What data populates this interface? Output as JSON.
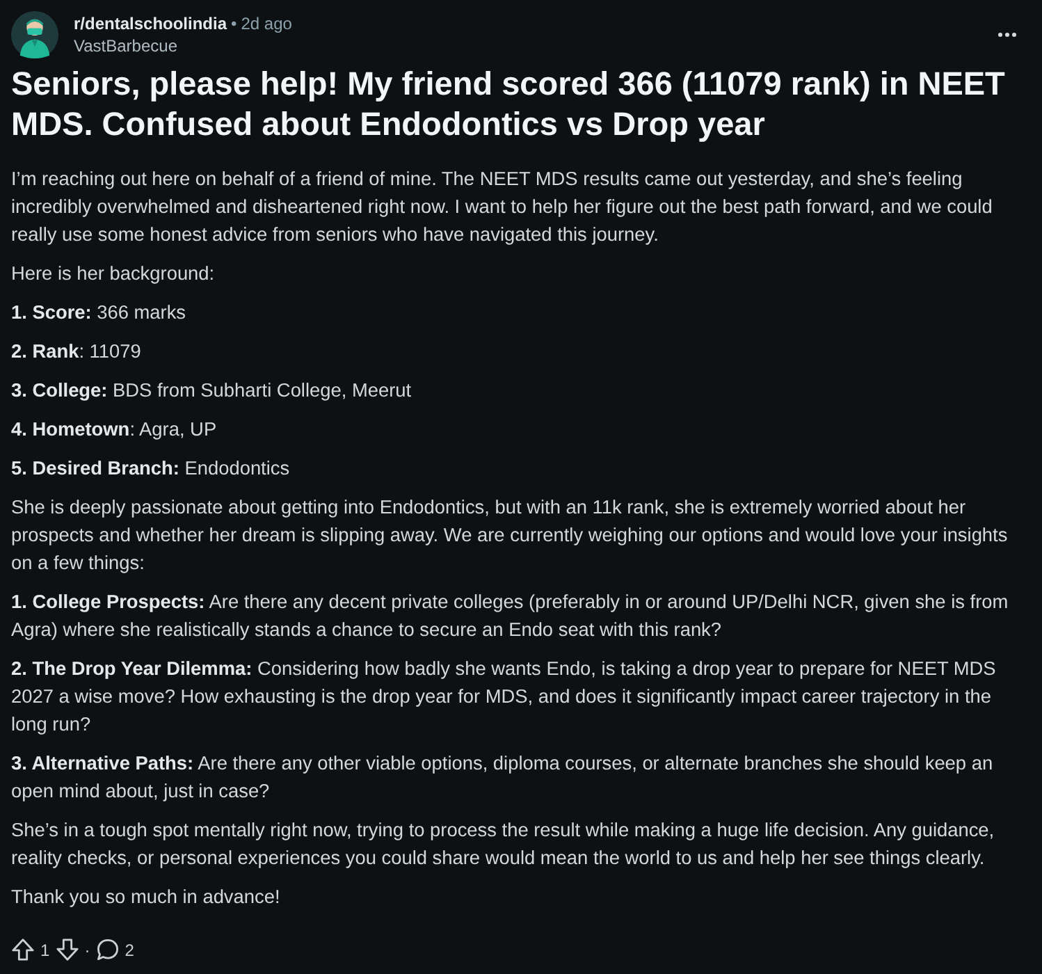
{
  "post": {
    "subreddit": "r/dentalschoolindia",
    "separator": "•",
    "age": "2d ago",
    "author": "VastBarbecue",
    "title": "Seniors, please help! My friend scored 366 (11079 rank) in NEET MDS. Confused about Endodontics vs Drop year",
    "body": [
      "I’m reaching out here on behalf of a friend of mine. The NEET MDS results came out yesterday, and she’s feeling incredibly overwhelmed and disheartened right now. I want to help her figure out the best path forward, and we could really use some honest advice from seniors who have navigated this journey.",
      "Here is her background:",
      "**1. Score:** 366 marks",
      "**2. Rank**: 11079",
      "**3. College:** BDS from Subharti College, Meerut",
      "**4. Hometown**: Agra, UP",
      "**5. Desired Branch:** Endodontics",
      "She is deeply passionate about getting into Endodontics, but with an 11k rank, she is extremely worried about her prospects and whether her dream is slipping away. We are currently weighing our options and would love your insights on a few things:",
      "**1. College Prospects:** Are there any decent private colleges (preferably in or around UP/Delhi NCR, given she is from Agra) where she realistically stands a chance to secure an Endo seat with this rank?",
      "**2. The Drop Year Dilemma:** Considering how badly she wants Endo, is taking a drop year to prepare for NEET MDS 2027 a wise move? How exhausting is the drop year for MDS, and does it significantly impact career trajectory in the long run?",
      "**3. Alternative Paths:** Are there any other viable options, diploma courses, or alternate branches she should keep an open mind about, just in case?",
      "She’s in a tough spot mentally right now, trying to process the result while making a huge life decision. Any guidance, reality checks, or personal experiences you could share would mean the world to us and help her see things clearly.",
      "Thank you so much in advance!"
    ]
  },
  "actions": {
    "upvotes": "1",
    "separator": "·",
    "comments": "2"
  }
}
